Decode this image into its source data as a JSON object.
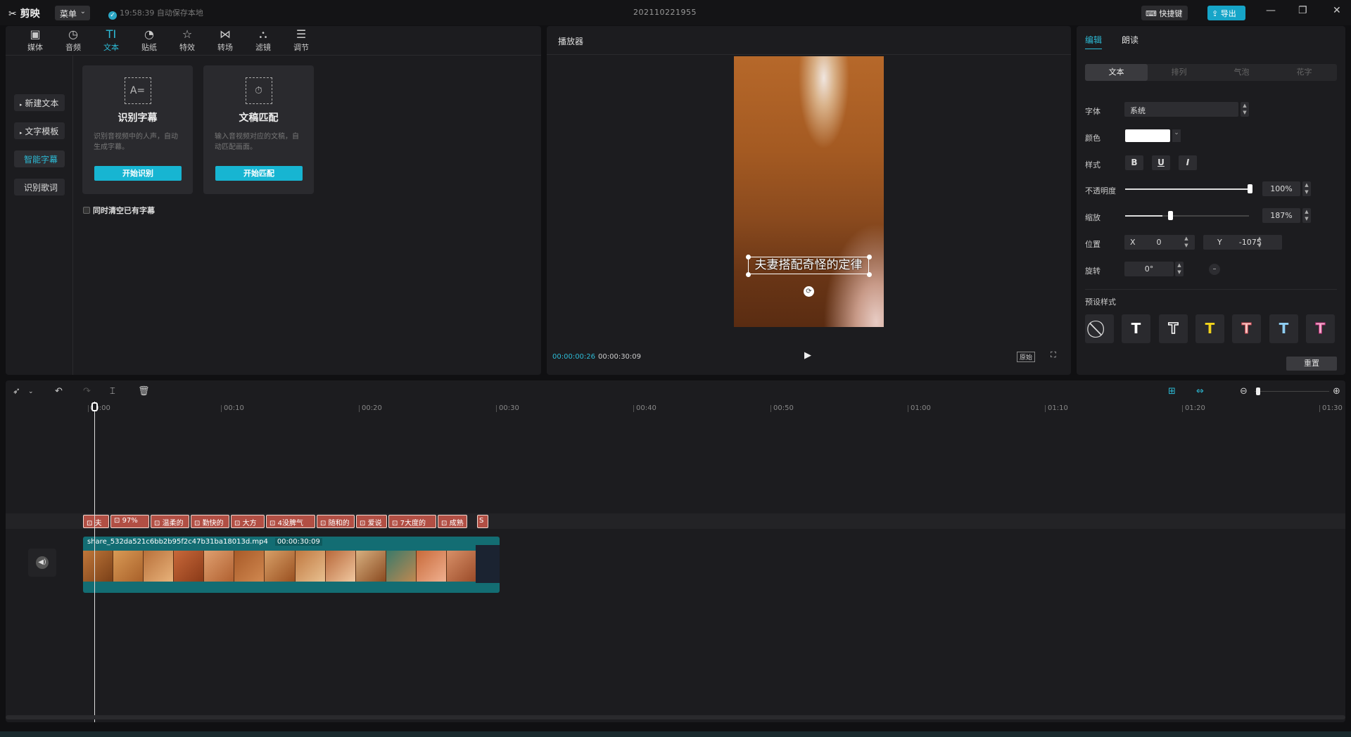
{
  "app": {
    "logo": "剪映",
    "menu_label": "菜单",
    "autosave": "19:58:39 自动保存本地",
    "project_title": "202110221955",
    "shortcut_label": "快捷键",
    "export_label": "导出",
    "window_controls": [
      "minimize-icon",
      "restore-icon",
      "close-icon"
    ]
  },
  "toolbar": {
    "tools": [
      {
        "label": "媒体",
        "icon": "media-icon"
      },
      {
        "label": "音频",
        "icon": "audio-icon"
      },
      {
        "label": "文本",
        "icon": "text-icon",
        "active": true
      },
      {
        "label": "贴纸",
        "icon": "sticker-icon"
      },
      {
        "label": "特效",
        "icon": "effects-icon"
      },
      {
        "label": "转场",
        "icon": "transition-icon"
      },
      {
        "label": "滤镜",
        "icon": "filter-icon"
      },
      {
        "label": "调节",
        "icon": "adjust-icon"
      }
    ]
  },
  "sidebar": {
    "items": [
      {
        "label": "新建文本"
      },
      {
        "label": "文字模板"
      },
      {
        "label": "智能字幕",
        "active": true
      },
      {
        "label": "识别歌词"
      }
    ]
  },
  "cards": [
    {
      "title": "识别字幕",
      "desc": "识别音视频中的人声，自动生成字幕。",
      "button": "开始识别"
    },
    {
      "title": "文稿匹配",
      "desc": "输入音视频对应的文稿，自动匹配画面。",
      "button": "开始匹配"
    }
  ],
  "clear_option": "同时清空已有字幕",
  "player": {
    "title": "播放器",
    "subtitle_text": "夫妻搭配奇怪的定律",
    "current_time": "00:00:00:26",
    "total_time": "00:00:30:09",
    "ratio_label": "原始"
  },
  "props": {
    "tabs": [
      "编辑",
      "朗读"
    ],
    "subtabs": [
      "文本",
      "排列",
      "气泡",
      "花字"
    ],
    "font_label": "字体",
    "font_value": "系统",
    "color_label": "颜色",
    "style_label": "样式",
    "opacity_label": "不透明度",
    "opacity_value": "100%",
    "opacity": 1.0,
    "scale_label": "缩放",
    "scale_value": "187%",
    "scale_slider": 0.37,
    "position_label": "位置",
    "x_label": "X",
    "x_value": "0",
    "y_label": "Y",
    "y_value": "-1075",
    "rotate_label": "旋转",
    "rotate_value": "0°",
    "preset_label": "预设样式",
    "reset_label": "重置",
    "text_color": "#ffffff"
  },
  "timeline": {
    "ruler": [
      "00:00",
      "00:10",
      "00:20",
      "00:30",
      "00:40",
      "00:50",
      "01:00",
      "01:10",
      "01:20",
      "01:30"
    ],
    "subtitle_clips": [
      "夫",
      "97%",
      "温柔的",
      "勤快的",
      "大方",
      "4没脾气",
      "随和的",
      "爱说",
      "7大度的",
      "成熟",
      "S"
    ],
    "video_clip_name": "share_532da521c6bb2b95f2c47b31ba18013d.mp4",
    "video_clip_duration": "00:00:30:09"
  },
  "colors": {
    "accent": "#2dbbd6",
    "subtitle_clip": "#b14f44",
    "video_clip": "#136d73"
  }
}
